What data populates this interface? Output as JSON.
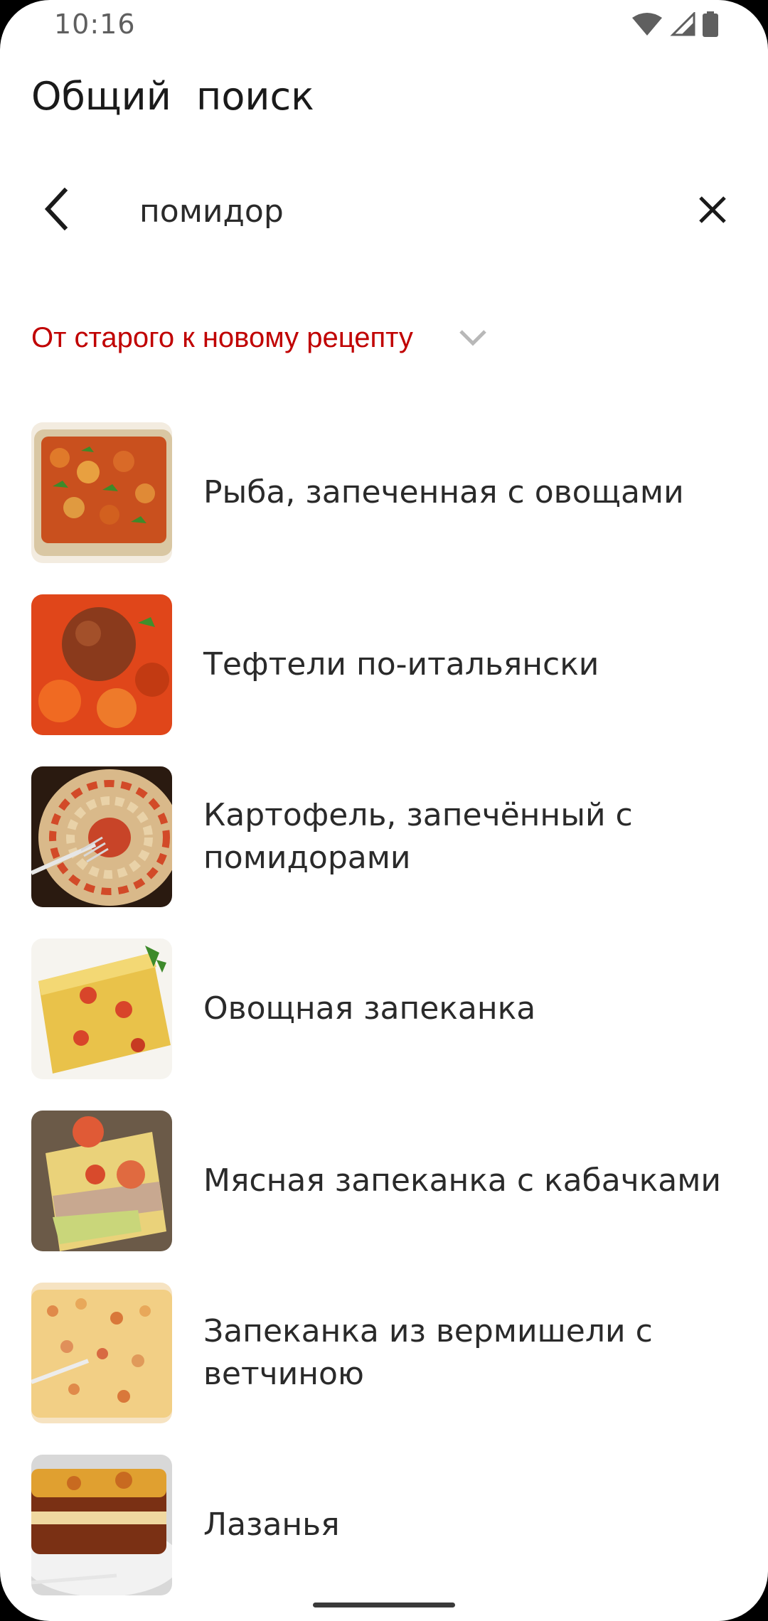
{
  "status_bar": {
    "time": "10:16",
    "icons": [
      "wifi-icon",
      "cellular-signal-icon",
      "battery-icon"
    ]
  },
  "header": {
    "title": "Общий  поиск"
  },
  "search": {
    "value": "помидор",
    "back_icon": "chevron-left-icon",
    "clear_icon": "close-icon"
  },
  "sort": {
    "selected": "От старого к новому рецепту",
    "color": "#c00000"
  },
  "recipes": [
    {
      "title": "Рыба, запеченная с овощами"
    },
    {
      "title": "Тефтели по-итальянски"
    },
    {
      "title": "Картофель, запечённый с помидорами"
    },
    {
      "title": "Овощная запеканка"
    },
    {
      "title": "Мясная запеканка с кабачками"
    },
    {
      "title": "Запеканка из вермишели с ветчиною"
    },
    {
      "title": "Лазанья"
    }
  ]
}
